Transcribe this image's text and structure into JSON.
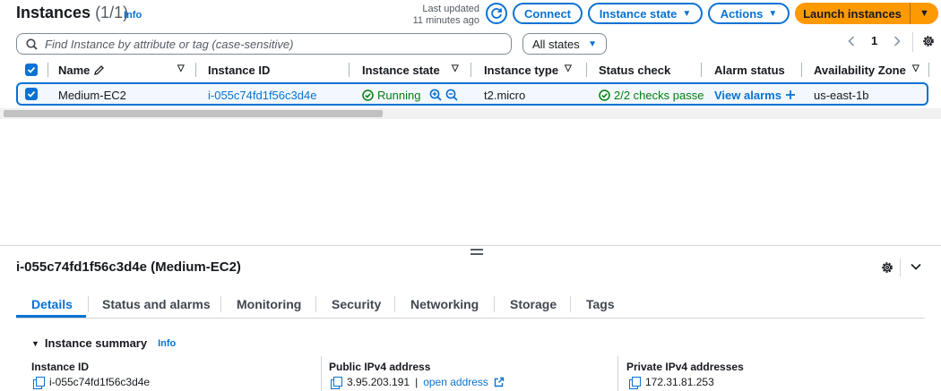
{
  "header": {
    "title": "Instances",
    "count": "(1/1)",
    "info": "Info",
    "last_updated_line1": "Last updated",
    "last_updated_line2": "11 minutes ago",
    "connect": "Connect",
    "instance_state": "Instance state",
    "actions": "Actions",
    "launch": "Launch instances"
  },
  "search": {
    "placeholder": "Find Instance by attribute or tag (case-sensitive)",
    "filter_value": "All states"
  },
  "pagination": {
    "current_page": "1"
  },
  "table": {
    "columns": [
      "Name",
      "Instance ID",
      "Instance state",
      "Instance type",
      "Status check",
      "Alarm status",
      "Availability Zone"
    ],
    "rows": [
      {
        "name": "Medium-EC2",
        "instance_id": "i-055c74fd1f56c3d4e",
        "state": "Running",
        "type": "t2.micro",
        "status_check": "2/2 checks passec",
        "alarm": "View alarms",
        "az": "us-east-1b"
      }
    ]
  },
  "details": {
    "title": "i-055c74fd1f56c3d4e (Medium-EC2)",
    "tabs": [
      "Details",
      "Status and alarms",
      "Monitoring",
      "Security",
      "Networking",
      "Storage",
      "Tags"
    ],
    "summary_heading": "Instance summary",
    "summary_info": "Info",
    "fields": [
      {
        "label": "Instance ID",
        "value": "i-055c74fd1f56c3d4e"
      },
      {
        "label": "Public IPv4 address",
        "value": "3.95.203.191",
        "extra": "open address"
      },
      {
        "label": "Private IPv4 addresses",
        "value": "172.31.81.253"
      }
    ]
  },
  "colors": {
    "accent": "#0972d3",
    "launch": "#ff9900",
    "success": "#037f0c",
    "selected_row_bg": "#f2f8fd"
  },
  "icons": [
    "refresh-icon",
    "caret-down-icon",
    "search-icon",
    "chevron-left-icon",
    "chevron-right-icon",
    "settings-icon",
    "pencil-icon",
    "checkbox-icon",
    "status-ok-icon",
    "zoom-in-icon",
    "zoom-out-icon",
    "plus-icon",
    "collapse-icon",
    "copy-icon",
    "external-link-icon",
    "drag-handle-icon"
  ]
}
